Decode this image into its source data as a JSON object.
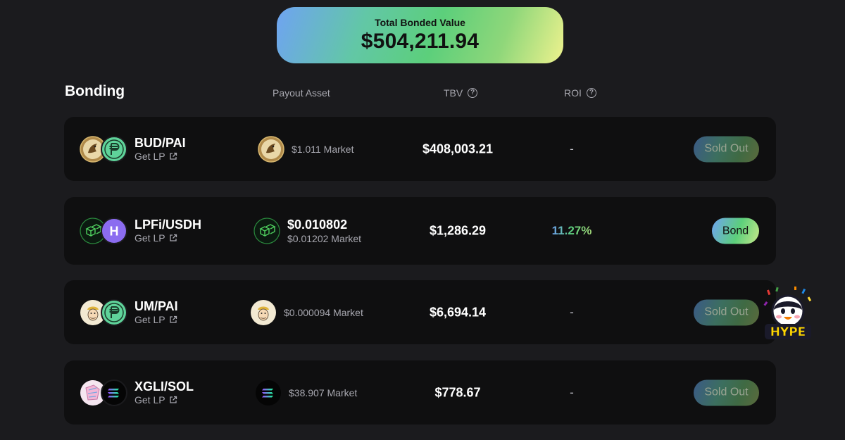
{
  "total": {
    "label": "Total Bonded Value",
    "value": "$504,211.94"
  },
  "header": {
    "title": "Bonding",
    "payout_asset": "Payout Asset",
    "tbv": "TBV",
    "roi": "ROI",
    "help_glyph": "?"
  },
  "get_lp_label": "Get LP",
  "rows": [
    {
      "pair": "BUD/PAI",
      "payout_price": "",
      "payout_market": "$1.011 Market",
      "tbv": "$408,003.21",
      "roi": "-",
      "button": "Sold Out"
    },
    {
      "pair": "LPFi/USDH",
      "payout_price": "$0.010802",
      "payout_market": "$0.01202 Market",
      "tbv": "$1,286.29",
      "roi": "11.27%",
      "button": "Bond"
    },
    {
      "pair": "UM/PAI",
      "payout_price": "",
      "payout_market": "$0.000094 Market",
      "tbv": "$6,694.14",
      "roi": "-",
      "button": "Sold Out"
    },
    {
      "pair": "XGLI/SOL",
      "payout_price": "",
      "payout_market": "$38.907 Market",
      "tbv": "$778.67",
      "roi": "-",
      "button": "Sold Out"
    }
  ],
  "sticker": {
    "text": "HYPE"
  },
  "icons": {
    "pai": "pai-token-icon",
    "bud": "bud-token-icon",
    "lpfi": "lpfi-token-icon",
    "usdh": "usdh-token-icon",
    "um": "um-token-icon",
    "xgli": "xgli-token-icon",
    "sol": "sol-token-icon",
    "external": "external-link-icon",
    "help": "help-icon"
  },
  "colors": {
    "background": "#1b1b1e",
    "row": "#0f0f10",
    "muted": "#a8a8b0",
    "accent_green": "#5ccf7b",
    "accent_blue": "#6fa3f2"
  }
}
